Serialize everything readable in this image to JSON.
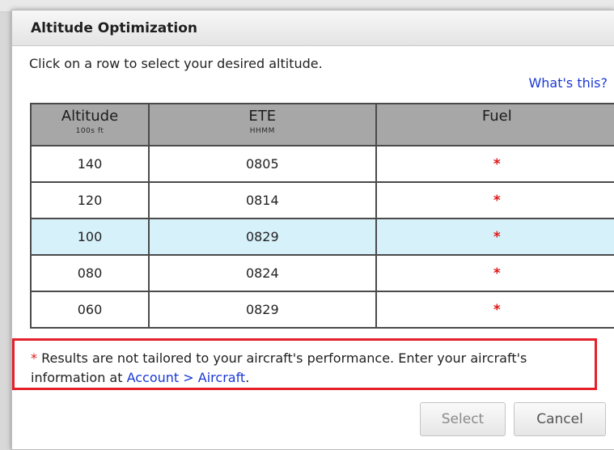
{
  "dialog": {
    "title": "Altitude Optimization",
    "instructions": "Click on a row to select your desired altitude.",
    "whats_this": "What's this?"
  },
  "table": {
    "columns": [
      {
        "label": "Altitude",
        "sublabel": "100s ft"
      },
      {
        "label": "ETE",
        "sublabel": "HHMM"
      },
      {
        "label": "Fuel",
        "sublabel": ""
      }
    ],
    "rows": [
      {
        "altitude": "140",
        "ete": "0805",
        "fuel": "*",
        "selected": false
      },
      {
        "altitude": "120",
        "ete": "0814",
        "fuel": "*",
        "selected": false
      },
      {
        "altitude": "100",
        "ete": "0829",
        "fuel": "*",
        "selected": true
      },
      {
        "altitude": "080",
        "ete": "0824",
        "fuel": "*",
        "selected": false
      },
      {
        "altitude": "060",
        "ete": "0829",
        "fuel": "*",
        "selected": false
      }
    ],
    "selected_row_color": "#d7f1fb"
  },
  "note": {
    "star": "*",
    "text": " Results are not tailored to your aircraft's performance. Enter your aircraft's information at ",
    "link": "Account > Aircraft",
    "end": "."
  },
  "buttons": {
    "select": "Select",
    "cancel": "Cancel"
  },
  "colors": {
    "highlight_border": "#e4202a",
    "link": "#1a38d4",
    "header_bg": "#a7a7a7"
  }
}
